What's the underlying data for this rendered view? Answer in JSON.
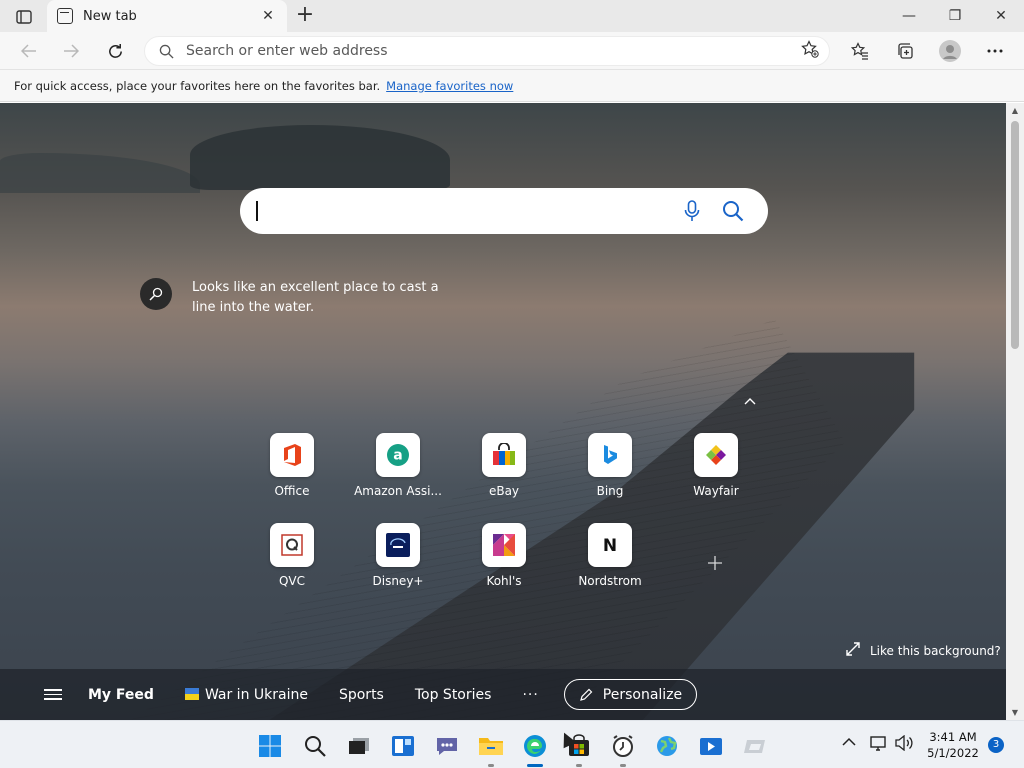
{
  "browser": {
    "tab": {
      "title": "New tab",
      "close": "✕"
    },
    "new_tab": "+",
    "window": {
      "minimize": "—",
      "restore": "❐",
      "close": "✕"
    },
    "toolbar": {
      "address_placeholder": "Search or enter web address"
    },
    "favorites_bar": {
      "text": "For quick access, place your favorites here on the favorites bar.",
      "link": "Manage favorites now"
    }
  },
  "newtab": {
    "background_caption": "Looks like an excellent place to cast a line into the water.",
    "quick_links": [
      {
        "label": "Office",
        "icon": "office-icon",
        "color": "#e8431a"
      },
      {
        "label": "Amazon Assi...",
        "icon": "amazon-icon",
        "color": "#16a085"
      },
      {
        "label": "eBay",
        "icon": "ebay-icon",
        "color": "#e53238"
      },
      {
        "label": "Bing",
        "icon": "bing-icon",
        "color": "#1b8be0"
      },
      {
        "label": "Wayfair",
        "icon": "wayfair-icon",
        "color": "#7b189f"
      },
      {
        "label": "QVC",
        "icon": "qvc-icon",
        "color": "#c0392b"
      },
      {
        "label": "Disney+",
        "icon": "disney-icon",
        "color": "#0a1e5c"
      },
      {
        "label": "Kohl's",
        "icon": "kohls-icon",
        "color": "#6b2c91"
      },
      {
        "label": "Nordstrom",
        "icon": "nordstrom-icon",
        "color": "#111111"
      }
    ],
    "like_background": "Like this background?",
    "feed": {
      "items": [
        "My Feed",
        "War in Ukraine",
        "Sports",
        "Top Stories"
      ],
      "more": "···",
      "personalize": "Personalize"
    }
  },
  "taskbar": {
    "clock": {
      "time": "3:41 AM",
      "date": "5/1/2022"
    },
    "notifications": "3",
    "accent": "#0067c0"
  }
}
